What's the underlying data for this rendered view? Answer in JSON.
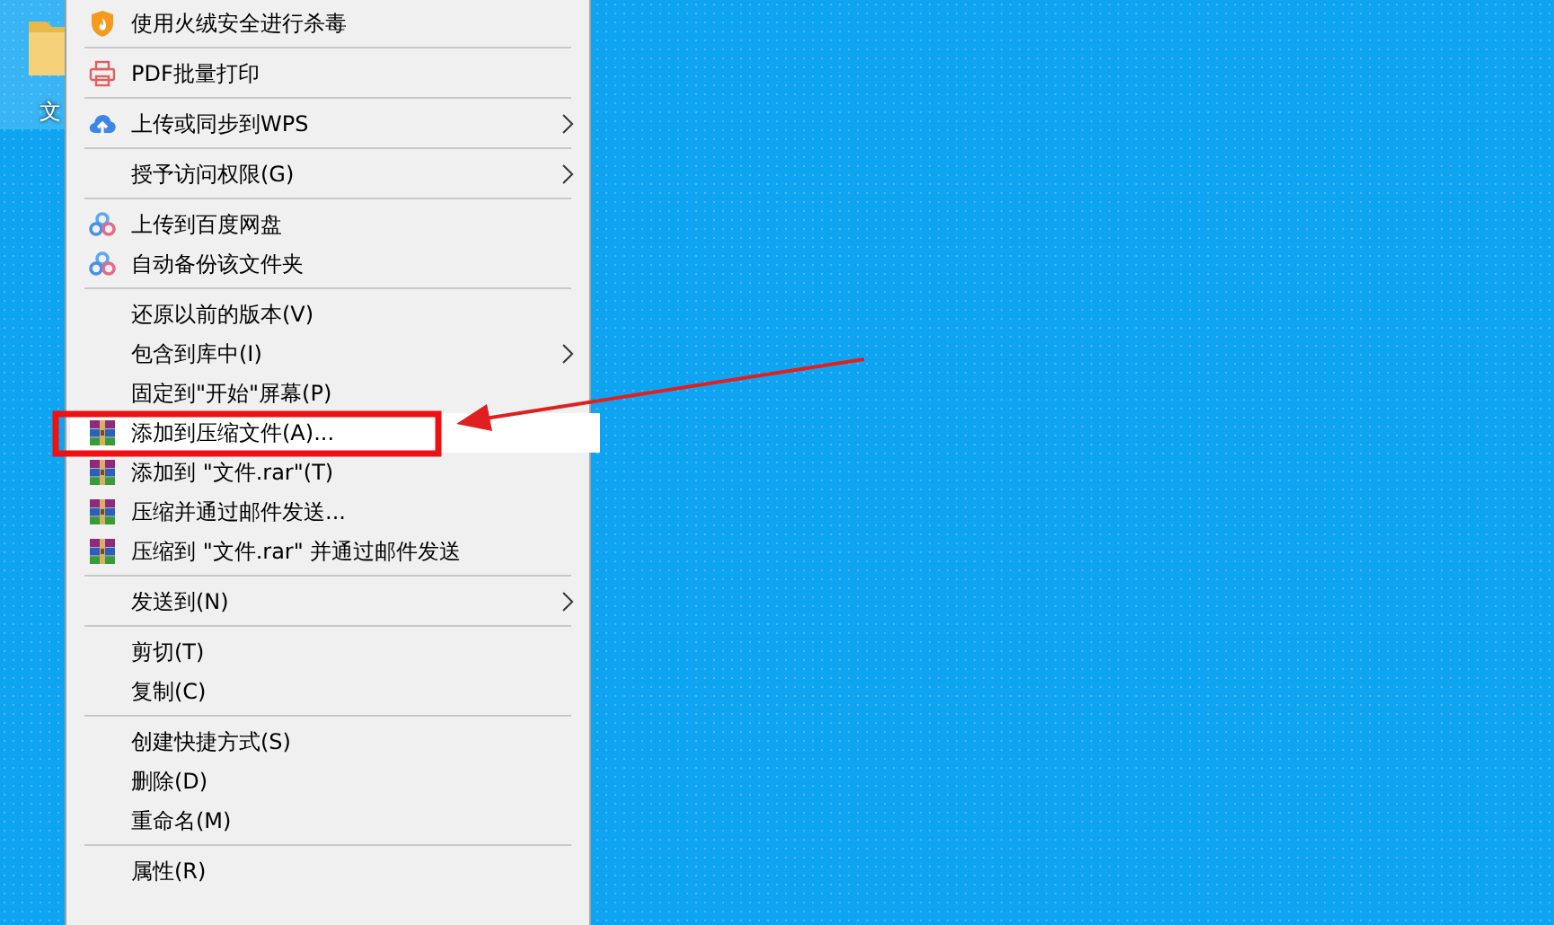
{
  "desktop": {
    "folder_label": "文"
  },
  "context_menu": {
    "items": [
      {
        "kind": "shield",
        "label": "使用火绒安全进行杀毒",
        "submenu": false,
        "selected": false
      },
      {
        "kind": "separator"
      },
      {
        "kind": "printer",
        "label": "PDF批量打印",
        "submenu": false,
        "selected": false
      },
      {
        "kind": "separator"
      },
      {
        "kind": "cloud",
        "label": "上传或同步到WPS",
        "submenu": true,
        "selected": false
      },
      {
        "kind": "separator"
      },
      {
        "kind": "plain",
        "label": "授予访问权限(G)",
        "submenu": true,
        "selected": false
      },
      {
        "kind": "separator"
      },
      {
        "kind": "rings",
        "label": "上传到百度网盘",
        "submenu": false,
        "selected": false
      },
      {
        "kind": "rings",
        "label": "自动备份该文件夹",
        "submenu": false,
        "selected": false
      },
      {
        "kind": "separator"
      },
      {
        "kind": "plain",
        "label": "还原以前的版本(V)",
        "submenu": false,
        "selected": false
      },
      {
        "kind": "plain",
        "label": "包含到库中(I)",
        "submenu": true,
        "selected": false
      },
      {
        "kind": "plain",
        "label": "固定到\"开始\"屏幕(P)",
        "submenu": false,
        "selected": false
      },
      {
        "kind": "archive",
        "label": "添加到压缩文件(A)...",
        "submenu": false,
        "selected": true
      },
      {
        "kind": "archive",
        "label": "添加到 \"文件.rar\"(T)",
        "submenu": false,
        "selected": false
      },
      {
        "kind": "archive",
        "label": "压缩并通过邮件发送...",
        "submenu": false,
        "selected": false
      },
      {
        "kind": "archive",
        "label": "压缩到 \"文件.rar\" 并通过邮件发送",
        "submenu": false,
        "selected": false
      },
      {
        "kind": "separator"
      },
      {
        "kind": "plain",
        "label": "发送到(N)",
        "submenu": true,
        "selected": false
      },
      {
        "kind": "separator"
      },
      {
        "kind": "plain",
        "label": "剪切(T)",
        "submenu": false,
        "selected": false
      },
      {
        "kind": "plain",
        "label": "复制(C)",
        "submenu": false,
        "selected": false
      },
      {
        "kind": "separator"
      },
      {
        "kind": "plain",
        "label": "创建快捷方式(S)",
        "submenu": false,
        "selected": false
      },
      {
        "kind": "plain",
        "label": "删除(D)",
        "submenu": false,
        "selected": false
      },
      {
        "kind": "plain",
        "label": "重命名(M)",
        "submenu": false,
        "selected": false
      },
      {
        "kind": "separator"
      },
      {
        "kind": "plain",
        "label": "属性(R)",
        "submenu": false,
        "selected": false
      }
    ]
  }
}
